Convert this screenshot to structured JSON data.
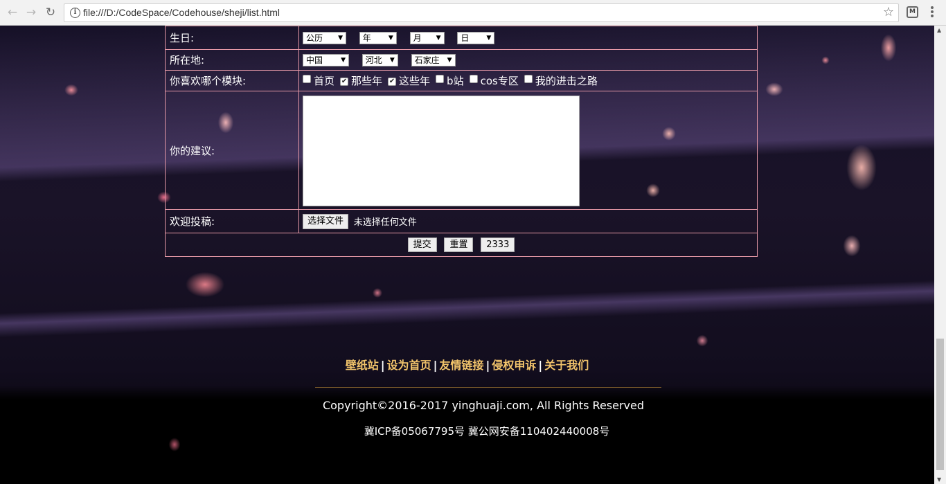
{
  "browser": {
    "url": "file:///D:/CodeSpace/Codehouse/sheji/list.html",
    "back_icon": "←",
    "forward_icon": "→",
    "reload_icon": "↻",
    "star_icon": "☆"
  },
  "form": {
    "birthday": {
      "label": "生日:",
      "selects": [
        "公历",
        "年",
        "月",
        "日"
      ]
    },
    "location": {
      "label": "所在地:",
      "selects": [
        "中国",
        "河北",
        "石家庄"
      ]
    },
    "modules": {
      "label": "你喜欢哪个模块:",
      "options": [
        {
          "label": "首页",
          "checked": false
        },
        {
          "label": "那些年",
          "checked": true
        },
        {
          "label": "这些年",
          "checked": true
        },
        {
          "label": "b站",
          "checked": false
        },
        {
          "label": "cos专区",
          "checked": false
        },
        {
          "label": "我的进击之路",
          "checked": false
        }
      ]
    },
    "suggestion": {
      "label": "你的建议:",
      "value": ""
    },
    "upload": {
      "label": "欢迎投稿:",
      "button": "选择文件",
      "status": "未选择任何文件"
    },
    "buttons": {
      "submit": "提交",
      "reset": "重置",
      "extra": "2333"
    }
  },
  "footer": {
    "links": [
      "壁纸站",
      "设为首页",
      "友情链接",
      "侵权申诉",
      "关于我们"
    ],
    "separator": "|",
    "copyright": "Copyright©2016-2017 yinghuaji.com, All Rights Reserved",
    "icp": "冀ICP备05067795号 冀公网安备110402440008号"
  }
}
